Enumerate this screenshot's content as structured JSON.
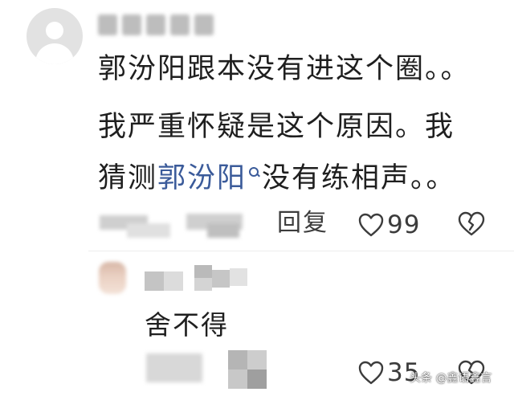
{
  "comment": {
    "lines": [
      "郭汾阳跟本没有进这个圈。。",
      "我严重怀疑是这个原因。我",
      {
        "before": "猜测",
        "link": "郭汾阳",
        "after": "没有练相声。。"
      }
    ],
    "actions": {
      "reply_label": "回复",
      "like_count": "99"
    }
  },
  "reply": {
    "text": "舍不得",
    "like_count": "35"
  },
  "watermark": "头条 @鑫语鑫言",
  "icons": [
    "user-avatar-icon",
    "search-icon",
    "heart-icon",
    "dislike-icon"
  ],
  "colors": {
    "link": "#3b5b9a",
    "text": "#1f1f1f",
    "muted": "#3c3c3c"
  }
}
